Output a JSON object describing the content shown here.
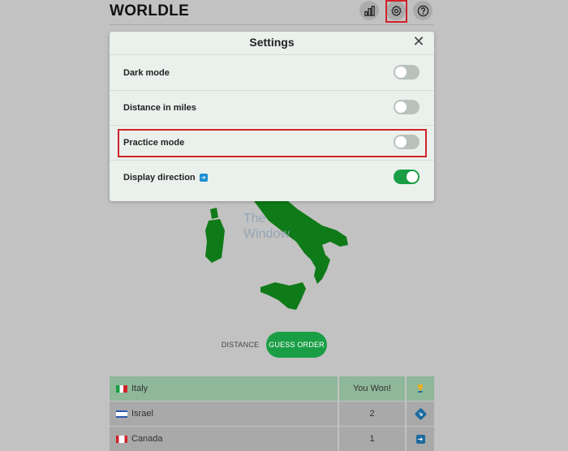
{
  "header": {
    "logo": "WORLDLE",
    "stats_icon": "bar-chart-icon",
    "settings_icon": "gear-icon",
    "help_icon": "question-mark-icon"
  },
  "settings": {
    "title": "Settings",
    "close_icon": "close-icon",
    "options": [
      {
        "label": "Dark mode",
        "enabled": false
      },
      {
        "label": "Distance in miles",
        "enabled": false
      },
      {
        "label": "Practice mode",
        "enabled": false
      },
      {
        "label": "Display direction",
        "enabled": true,
        "info_icon": "arrow-info-icon"
      }
    ]
  },
  "watermark": {
    "line1": "The",
    "line2": "Window"
  },
  "tabs": {
    "distance": "DISTANCE",
    "guess_order": "GUESS ORDER"
  },
  "guesses": [
    {
      "country": "Italy",
      "result": "You Won!",
      "icon": "trophy-icon",
      "flag": "italy-flag"
    },
    {
      "country": "Israel",
      "result": "2",
      "icon": "direction-arrow-icon",
      "flag": "israel-flag"
    },
    {
      "country": "Canada",
      "result": "1",
      "icon": "direction-arrow-icon",
      "flag": "canada-flag"
    }
  ],
  "colors": {
    "accent_green": "#1a9e45",
    "highlight_red": "#d0232a",
    "map_green": "#0f7a18"
  }
}
